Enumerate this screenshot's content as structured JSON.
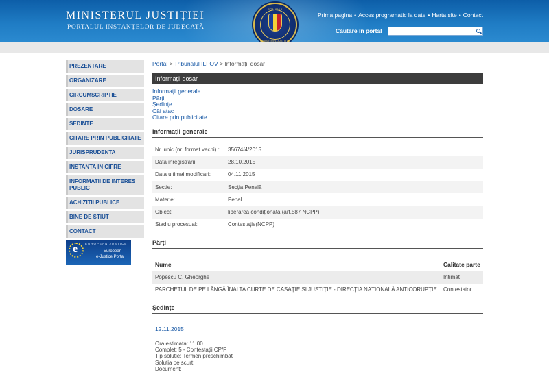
{
  "header": {
    "ministry": "MINISTERUL JUSTIȚIEI",
    "portal_name": "PORTALUL INSTANȚELOR DE JUDECATĂ",
    "seal_top": "ROMÂNIA",
    "seal_bottom": "MINISTERUL JUSTIȚIEI",
    "nav": [
      "Prima pagina",
      "Acces programatic la date",
      "Harta site",
      "Contact"
    ],
    "search_label": "Căutare în portal",
    "search_value": ""
  },
  "sidebar": {
    "items": [
      "PREZENTARE",
      "ORGANIZARE",
      "CIRCUMSCRIPTIE",
      "DOSARE",
      "SEDINTE",
      "CITARE PRIN PUBLICITATE",
      "JURISPRUDENTA",
      "INSTANTA IN CIFRE",
      "INFORMATII DE INTERES PUBLIC",
      "ACHIZITII PUBLICE",
      "BINE DE STIUT",
      "CONTACT"
    ],
    "banner": {
      "t1": "EUROPEAN JUSTICE",
      "t2": "European",
      "t3": "e-Justice Portal",
      "letter": "e"
    }
  },
  "breadcrumb": {
    "portal": "Portal",
    "court": "Tribunalul ILFOV",
    "current": "Informații dosar",
    "sep": ">"
  },
  "title": "Informații dosar",
  "quicklinks": [
    "Informații generale",
    "Părți",
    "Ședințe",
    "Căi atac",
    "Citare prin publicitate"
  ],
  "info": {
    "heading": "Informații generale",
    "rows": [
      {
        "k": "Nr. unic (nr. format vechi) :",
        "v": "35674/4/2015"
      },
      {
        "k": "Data inregistrarii",
        "v": "28.10.2015"
      },
      {
        "k": "Data ultimei modificari:",
        "v": "04.11.2015"
      },
      {
        "k": "Sectie:",
        "v": "Secția Penală"
      },
      {
        "k": "Materie:",
        "v": "Penal"
      },
      {
        "k": "Obiect:",
        "v": "liberarea condiționată (art.587 NCPP)"
      },
      {
        "k": "Stadiu procesual:",
        "v": "Contestație(NCPP)"
      }
    ]
  },
  "parti": {
    "heading": "Părți",
    "col_name": "Nume",
    "col_role": "Calitate parte",
    "rows": [
      {
        "name": "Popescu C. Gheorghe",
        "role": "Intimat"
      },
      {
        "name": "PARCHETUL DE PE LÂNGĂ ÎNALTA CURTE DE CASAȚIE SI JUSTIȚIE - DIRECȚIA NAȚIONALĂ ANTICORUPȚIE",
        "role": "Contestator"
      }
    ]
  },
  "sedinte": {
    "heading": "Ședințe",
    "date": "12.11.2015",
    "lines": [
      "Ora estimata: 11:00",
      "Complet: 5 - Contestaţii CP/F",
      "Tip solutie: Termen preschimbat",
      "Solutia pe scurt:",
      "Document:"
    ]
  },
  "colors": {
    "header_blue": "#1f7cc4",
    "link_blue": "#1a5aa6",
    "title_bar": "#3d3d3d",
    "sidebar_bg": "#e3e3e3"
  }
}
